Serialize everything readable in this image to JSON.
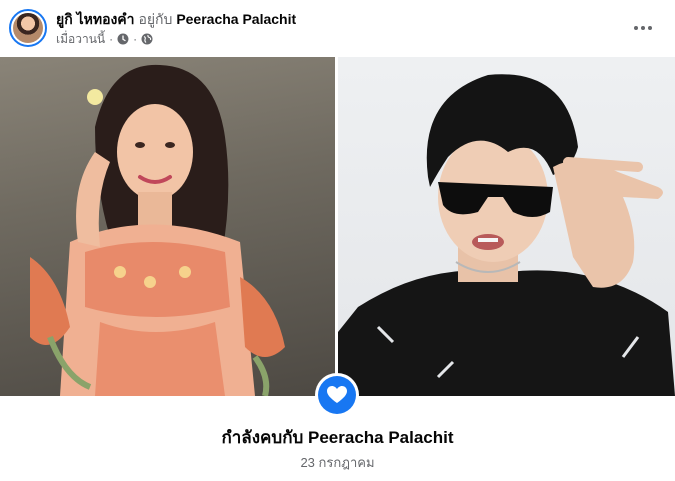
{
  "header": {
    "author": "ยูกิ ไหทองคำ",
    "with_text": "อยู่กับ",
    "tagged_person": "Peeracha Palachit",
    "timestamp": "เมื่อวานนี้",
    "icons": [
      "clock-icon",
      "globe-icon",
      "more-options-icon"
    ]
  },
  "photos": [
    {
      "name": "left-photo"
    },
    {
      "name": "right-photo"
    }
  ],
  "event": {
    "icon": "heart-icon",
    "title": "กำลังคบกับ Peeracha Palachit",
    "date": "23 กรกฎาคม"
  },
  "colors": {
    "accent": "#1877f2",
    "secondary_text": "#65676b",
    "primary_text": "#050505"
  }
}
